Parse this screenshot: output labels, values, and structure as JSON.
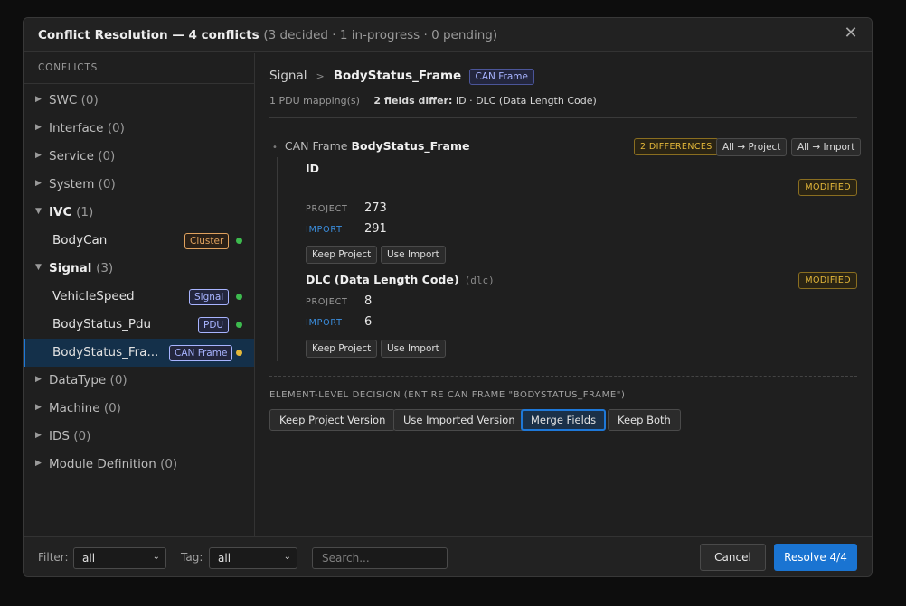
{
  "dialog": {
    "title_main": "Conflict Resolution — 4 conflicts",
    "title_sub": "(3 decided · 1 in-progress · 0 pending)"
  },
  "sidebar": {
    "header": "CONFLICTS",
    "categories": [
      {
        "label": "SWC",
        "count": "(0)"
      },
      {
        "label": "Interface",
        "count": "(0)"
      },
      {
        "label": "Service",
        "count": "(0)"
      },
      {
        "label": "System",
        "count": "(0)"
      },
      {
        "label": "IVC",
        "count": "(1)"
      },
      {
        "label": "Signal",
        "count": "(3)"
      },
      {
        "label": "DataType",
        "count": "(0)"
      },
      {
        "label": "Machine",
        "count": "(0)"
      },
      {
        "label": "IDS",
        "count": "(0)"
      },
      {
        "label": "Module Definition",
        "count": "(0)"
      }
    ],
    "ivc_children": [
      {
        "label": "BodyCan",
        "badge": "Cluster",
        "status": "decided"
      }
    ],
    "signal_children": [
      {
        "label": "VehicleSpeed",
        "badge": "Signal",
        "status": "decided"
      },
      {
        "label": "BodyStatus_Pdu",
        "badge": "PDU",
        "status": "decided"
      },
      {
        "label": "BodyStatus_Fra...",
        "badge": "CAN Frame",
        "status": "in-progress"
      }
    ]
  },
  "colors": {
    "decided": "#3dba4e",
    "in_progress": "#e4b83a",
    "accent": "#1a74d2"
  },
  "main": {
    "crumb_type": "Signal",
    "crumb_sep": ">",
    "crumb_name": "BodyStatus_Frame",
    "crumb_tag": "CAN Frame",
    "meta_mappings": "1 PDU mapping(s)",
    "meta_diff_bold": "2 fields differ:",
    "meta_diff_rest": " ID · DLC (Data Length Code)",
    "frame_prefix": "CAN Frame",
    "frame_name": "BodyStatus_Frame",
    "differences_badge": "2 DIFFERENCES",
    "all_project": "All → Project",
    "all_import": "All → Import",
    "fields": [
      {
        "name": "ID",
        "code": "",
        "status": "MODIFIED",
        "project_label": "PROJECT",
        "project_value": "273",
        "import_label": "IMPORT",
        "import_value": "291",
        "keep_label": "Keep Project",
        "use_label": "Use Import"
      },
      {
        "name": "DLC (Data Length Code)",
        "code": "(dlc)",
        "status": "MODIFIED",
        "project_label": "PROJECT",
        "project_value": "8",
        "import_label": "IMPORT",
        "import_value": "6",
        "keep_label": "Keep Project",
        "use_label": "Use Import"
      }
    ],
    "decision_label": "ELEMENT-LEVEL DECISION (ENTIRE CAN FRAME \"BODYSTATUS_FRAME\")",
    "decisions": [
      "Keep Project Version",
      "Use Imported Version",
      "Merge Fields",
      "Keep Both"
    ],
    "active_decision": "Merge Fields"
  },
  "footer": {
    "filter_label": "Filter:",
    "filter_value": "all",
    "tag_label": "Tag:",
    "tag_value": "all",
    "search_placeholder": "Search...",
    "cancel": "Cancel",
    "resolve": "Resolve 4/4"
  }
}
